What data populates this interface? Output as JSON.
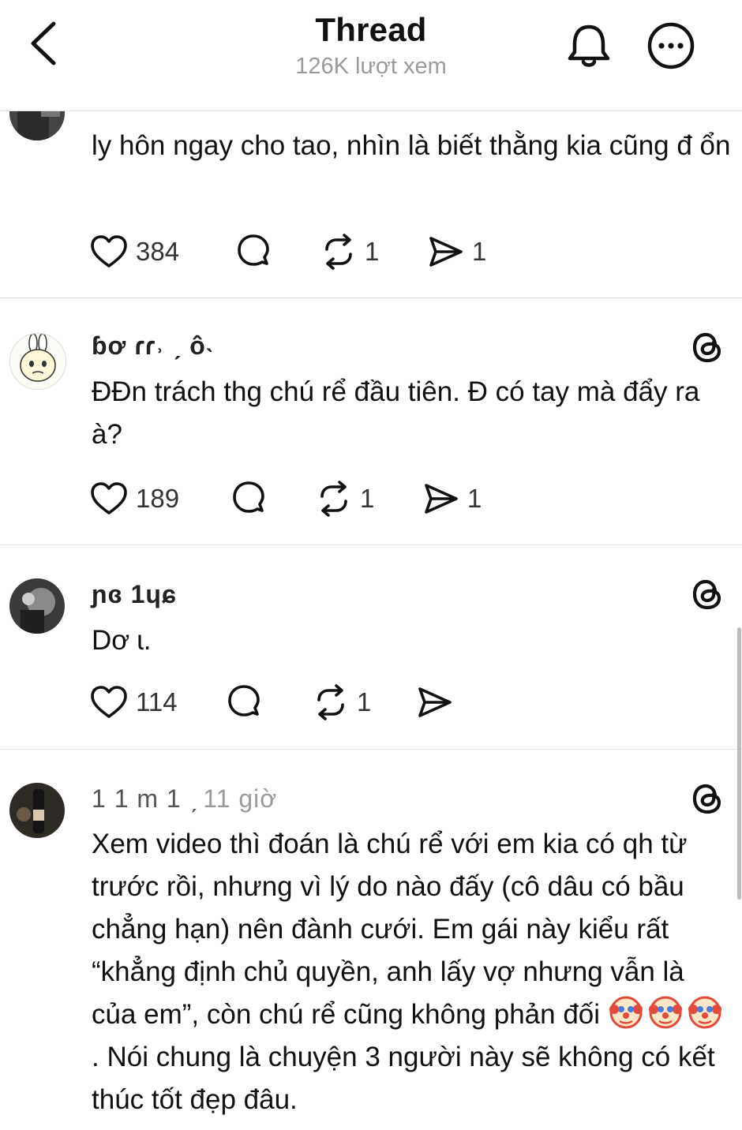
{
  "header": {
    "title": "Thread",
    "views": "126K lượt xem"
  },
  "icons": {
    "back": "chevron-left-icon",
    "bell": "bell-icon",
    "more": "more-horizontal-icon",
    "like": "heart-icon",
    "reply": "comment-icon",
    "repost": "repost-icon",
    "share": "send-icon",
    "threads": "threads-logo-icon",
    "emoji": "clown-face-emoji"
  },
  "posts": [
    {
      "text": "ly hôn ngay  cho tao, nhìn là biết thằng kia cũng đ ổn",
      "likes": "384",
      "reposts": "1",
      "shares": "1"
    },
    {
      "username": "ɓơ   ɾɾ˒   ˏ ô˴",
      "text": "ĐĐn trách thg chú rể đầu tiên. Đ có tay mà đẩy ra à?",
      "likes": "189",
      "reposts": "1",
      "shares": "1"
    },
    {
      "username": "ɲɞ 1ɥɕ",
      "text": "Dơ ɩ.",
      "likes": "114",
      "reposts": "1"
    },
    {
      "username": "1  1     m  1    ˏ",
      "time": "11 giờ",
      "text_part1": "Xem video thì đoán là chú rể với em kia có qh từ trước rồi, nhưng vì lý do nào đấy (cô dâu có bầu chẳng hạn) nên đành cưới. Em gái này kiểu rất “khẳng định chủ quyền, anh lấy vợ nhưng vẫn là của em”, còn chú rể cũng không phản đối ",
      "text_part2": ". Nói chung là chuyện 3 người này sẽ không có kết thúc tốt đẹp đâu."
    }
  ],
  "colors": {
    "text": "#111111",
    "muted": "#9a9a9a",
    "divider": "#e4e4e4"
  }
}
